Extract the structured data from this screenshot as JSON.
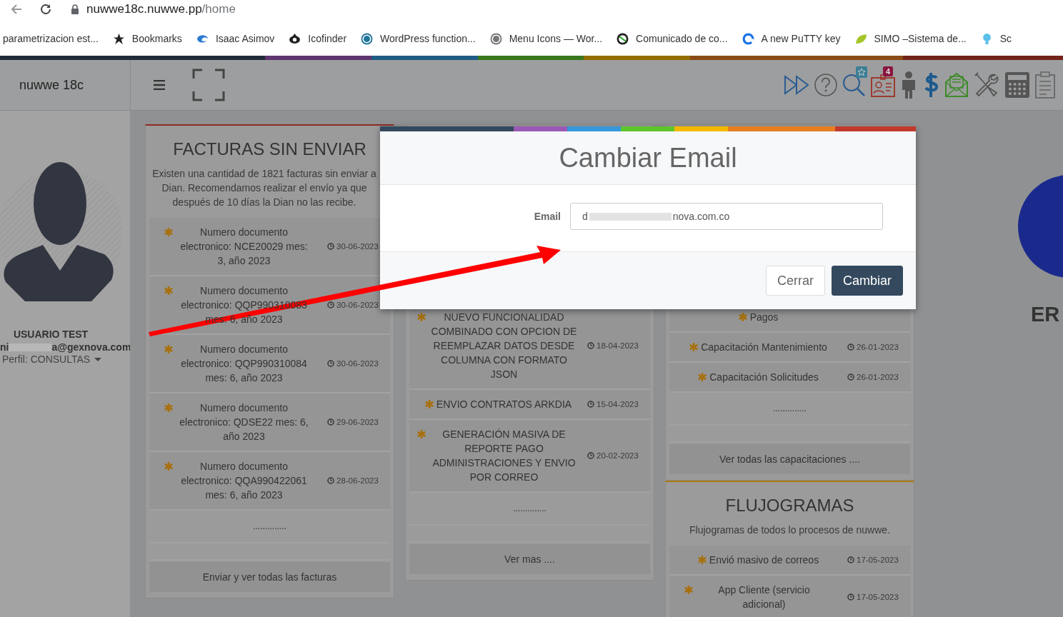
{
  "browser": {
    "url_host": "nuwwe18c.nuwwe.pp",
    "url_path": "/home",
    "bookmarks": [
      {
        "label": "parametrizacion est..."
      },
      {
        "label": "Bookmarks"
      },
      {
        "label": "Isaac Asimov"
      },
      {
        "label": "Icofinder"
      },
      {
        "label": "WordPress function..."
      },
      {
        "label": "Menu Icons — Wor..."
      },
      {
        "label": "Comunicado de co..."
      },
      {
        "label": "A new PuTTY key"
      },
      {
        "label": "SIMO –Sistema de..."
      },
      {
        "label": "Sc"
      }
    ]
  },
  "header": {
    "brand": "nuwwe 18c",
    "notification_count": "4"
  },
  "sidebar": {
    "user_name": "USUARIO TEST",
    "email_start": "ni",
    "email_end": "a@gexnova.com",
    "profile": "Perfil: CONSULTAS"
  },
  "panels": [
    {
      "title": "FACTURAS SIN ENVIAR",
      "description": "Existen una cantidad de 1821 facturas sin enviar a Dian. Recomendamos realizar el envío ya que después de 10 días la Dian no las recibe.",
      "items": [
        {
          "text": "Numero documento electronico: NCE20029 mes: 3, año 2023",
          "date": "30-06-2023"
        },
        {
          "text": "Numero documento electronico: QQP990310083 mes: 6, año 2023",
          "date": "30-06-2023"
        },
        {
          "text": "Numero documento electronico: QQP990310084 mes: 6, año 2023",
          "date": "30-06-2023"
        },
        {
          "text": "Numero documento electronico: QDSE22 mes: 6, año 2023",
          "date": "29-06-2023"
        },
        {
          "text": "Numero documento electronico: QQA990422061 mes: 6, año 2023",
          "date": "28-06-2023"
        }
      ],
      "more": "..............",
      "button": "Enviar y ver todas las facturas"
    },
    {
      "items": [
        {
          "text": "NUEVO FUNCIONALIDAD COMBINADO CON OPCION DE REEMPLAZAR DATOS DESDE COLUMNA CON FORMATO JSON",
          "date": "18-04-2023"
        },
        {
          "text": "ENVIO CONTRATOS ARKDIA",
          "date": "15-04-2023"
        },
        {
          "text": "GENERACIÓN MASIVA DE REPORTE PAGO ADMINISTRACIONES Y ENVIO POR CORREO",
          "date": "20-02-2023"
        }
      ],
      "more": "..............",
      "button": "Ver mas ...."
    },
    {
      "items": [
        {
          "text": "Pagos"
        },
        {
          "text": "Capacitación Mantenimiento",
          "date": "26-01-2023"
        },
        {
          "text": "Capacitación Solicitudes",
          "date": "26-01-2023"
        }
      ],
      "more": "..............",
      "button": "Ver todas las capacitaciones ...."
    },
    {
      "title": "FLUJOGRAMAS",
      "description": "Flujogramas de todos lo procesos de nuwwe.",
      "items": [
        {
          "text": "Envió masivo de correos",
          "date": "17-05-2023"
        },
        {
          "text": "App Cliente (servicio adicional)",
          "date": "17-05-2023"
        }
      ]
    }
  ],
  "right_area": {
    "heading": "ER"
  },
  "modal": {
    "title": "Cambiar Email",
    "field_label": "Email",
    "value_start": "d",
    "value_end": "nova.com.co",
    "buttons": [
      {
        "label": "Cerrar",
        "kind": "secondary"
      },
      {
        "label": "Cambiar",
        "kind": "primary"
      }
    ]
  }
}
